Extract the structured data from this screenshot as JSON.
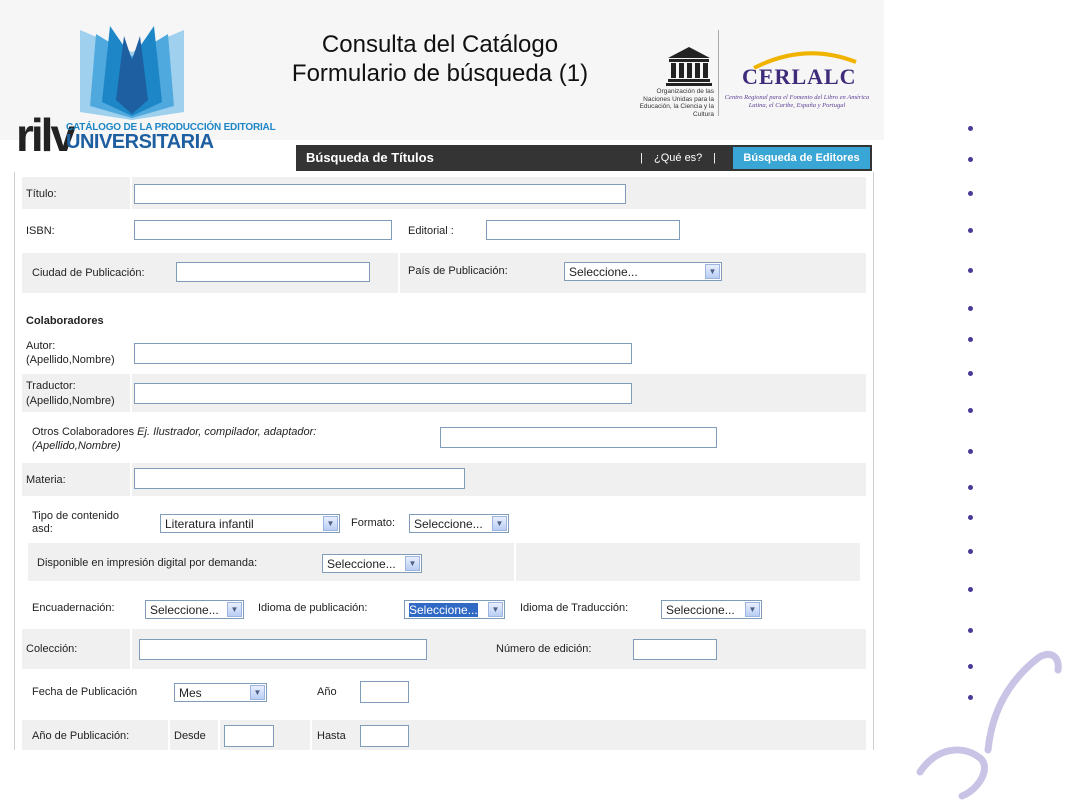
{
  "slide": {
    "title_line1": "Consulta del Catálogo",
    "title_line2": "Formulario de búsqueda (1)"
  },
  "logos": {
    "rilv": {
      "wordmark": "rilv",
      "subtitle": "CATÁLOGO DE LA PRODUCCIÓN EDITORIAL",
      "name": "UNIVERSITARIA",
      "colors": [
        "#1d86c6",
        "#1d5fa0",
        "#9fd0ee"
      ]
    },
    "unesco": {
      "caption": "Organización de las Naciones Unidas para la Educación, la Ciencia y la Cultura"
    },
    "cerlalc": {
      "name": "CERLALC",
      "description": "Centro Regional para el Fomento del Libro en América Latina, el Caribe, España y Portugal",
      "color": "#3e2c7b"
    }
  },
  "nav": {
    "title": "Búsqueda de Títulos",
    "separator": "|",
    "link": "¿Qué es?",
    "button": "Búsqueda de Editores",
    "button_color": "#3aa6d5"
  },
  "form": {
    "titulo_label": "Título:",
    "isbn_label": "ISBN:",
    "editorial_label": "Editorial :",
    "ciudad_label": "Ciudad de Publicación:",
    "pais_label": "País de Publicación:",
    "pais_value": "Seleccione...",
    "colaboradores_heading": "Colaboradores",
    "autor_label": "Autor:",
    "autor_hint": "(Apellido,Nombre)",
    "traductor_label": "Traductor:",
    "traductor_hint": "(Apellido,Nombre)",
    "otros_label": "Otros Colaboradores",
    "otros_example": "Ej. Ilustrador, compilador, adaptador:",
    "otros_hint": "(Apellido,Nombre)",
    "materia_label": "Materia:",
    "tipo_label_line1": "Tipo de contenido",
    "tipo_label_line2": "asd:",
    "tipo_value": "Literatura infantil",
    "formato_label": "Formato:",
    "formato_value": "Seleccione...",
    "disponible_label": "Disponible en impresión digital por demanda:",
    "disponible_value": "Seleccione...",
    "encuadernacion_label": "Encuadernación:",
    "encuadernacion_value": "Seleccione...",
    "idioma_pub_label": "Idioma de publicación:",
    "idioma_pub_value": "Seleccione...",
    "idioma_trad_label": "Idioma de Traducción:",
    "idioma_trad_value": "Seleccione...",
    "coleccion_label": "Colección:",
    "numero_edicion_label": "Número de edición:",
    "fecha_label": "Fecha de Publicación",
    "mes_value": "Mes",
    "anio_label": "Año",
    "anio_pub_label": "Año de Publicación:",
    "desde_label": "Desde",
    "hasta_label": "Hasta"
  },
  "decor": {
    "bullet_color": "#4b3b96",
    "swirl_color": "#c9c3e6"
  }
}
